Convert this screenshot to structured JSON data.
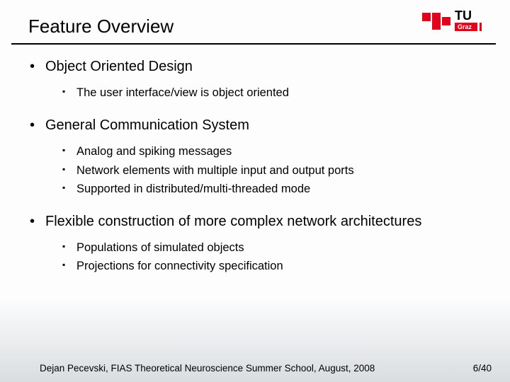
{
  "title": "Feature Overview",
  "bullets": {
    "b1": {
      "label": "Object Oriented Design",
      "sub": {
        "s1": "The user interface/view is object oriented"
      }
    },
    "b2": {
      "label": "General Communication System",
      "sub": {
        "s1": "Analog and spiking messages",
        "s2": "Network elements with multiple input and output ports",
        "s3": "Supported in distributed/multi-threaded mode"
      }
    },
    "b3": {
      "label": "Flexible construction of more complex network architectures",
      "sub": {
        "s1": "Populations of simulated objects",
        "s2": "Projections for connectivity specification"
      }
    }
  },
  "footer": {
    "author_line": "Dejan Pecevski, FIAS Theoretical Neuroscience Summer School, August, 2008",
    "page": "6/40"
  },
  "logo": {
    "name": "TU Graz",
    "color": "#e2001a"
  }
}
